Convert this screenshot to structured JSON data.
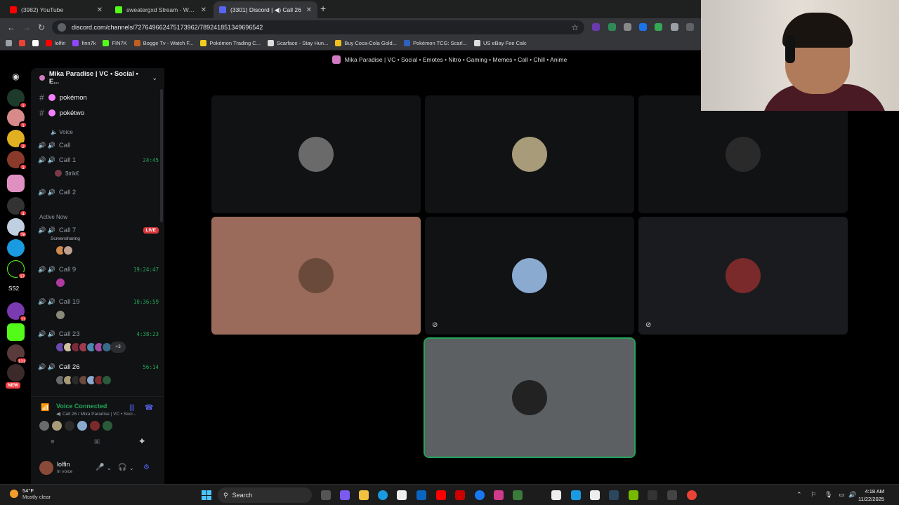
{
  "browser": {
    "tabs": [
      {
        "title": "(3982) YouTube",
        "color": "#ff0000",
        "active": false
      },
      {
        "title": "sweatergxd Stream - Watch Live",
        "color": "#53fc18",
        "active": false
      },
      {
        "title": "(3301) Discord | ◀) Call 26",
        "color": "#5865f2",
        "active": true
      }
    ],
    "url": "discord.com/channels/727649662475173962/789241851349696542",
    "bookmarks": [
      "lolfin",
      "finn7k",
      "FIN7K",
      "Bogge Tv - Watch F...",
      "Pokémon Trading C...",
      "Scarface - Stay Hun...",
      "Buy Coca-Cola Gold...",
      "Pokémon TCG: Scarl...",
      "US eBay Fee Calc"
    ]
  },
  "window_title": "Mika Paradise | VC • Social • Emotes • Nitro • Gaming • Memes • Call • Chill • Anime",
  "rail": {
    "ss2": "SS2",
    "new": "NEW",
    "badges": [
      "1",
      "1",
      "2",
      "1",
      "4",
      "4",
      "76",
      "17",
      "11",
      "131"
    ]
  },
  "sidebar": {
    "server_name": "Mika Paradise | VC • Social • E...",
    "channels": [
      "pokémon",
      "pokétwo"
    ],
    "voice_category": "Voice",
    "voice": [
      {
        "name": "Call",
        "time": ""
      },
      {
        "name": "Call 1",
        "time": "24:45"
      },
      {
        "name": "Call 2",
        "time": ""
      }
    ],
    "member": "$trik€",
    "active_now": "Active Now",
    "active": [
      {
        "name": "Call 7",
        "badge": "LIVE",
        "sub": "Screensharing"
      },
      {
        "name": "Call 9",
        "time": "19:24:47"
      },
      {
        "name": "Call 19",
        "time": "10:36:59"
      },
      {
        "name": "Call 23",
        "time": "4:38:23",
        "more": "+3"
      },
      {
        "name": "Call 26",
        "time": "56:14"
      }
    ]
  },
  "voice_panel": {
    "status": "Voice Connected",
    "location": "◀) Call 26 / Mika Paradise | VC • Soci..."
  },
  "user": {
    "name": "lolfin",
    "status": "In voice"
  },
  "tiles": [
    {
      "bg": "#111214",
      "avatar": "#6a6a6a"
    },
    {
      "bg": "#111214",
      "avatar": "#a89b7a"
    },
    {
      "bg": "#111214",
      "avatar": "#2a2a2a"
    },
    {
      "bg": "#9a6a5a",
      "avatar": "#6a4a3a"
    },
    {
      "bg": "#111214",
      "avatar": "#8aaad0",
      "muted": true
    },
    {
      "bg": "#1a1b1e",
      "avatar": "#7a2a2a",
      "muted": true
    },
    {
      "bg": "#5c6063",
      "avatar": "#222222",
      "speaking": true
    }
  ],
  "taskbar": {
    "temp": "54°F",
    "weather": "Mostly clear",
    "search": "Search",
    "time": "4:18 AM",
    "date": "11/22/2025"
  },
  "colors": {
    "accent": "#5865f2",
    "online": "#23a55a",
    "live": "#da373c"
  }
}
